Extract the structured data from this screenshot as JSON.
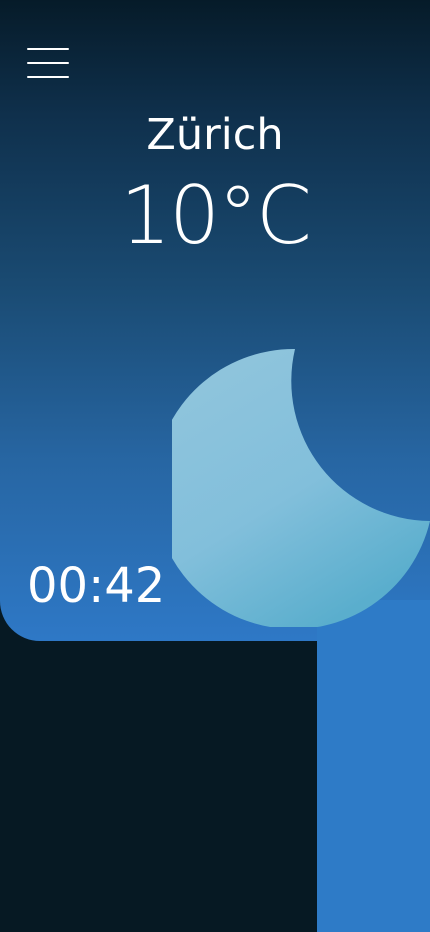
{
  "location": {
    "city": "Zürich"
  },
  "weather": {
    "temperature": "10°C",
    "condition_icon": "moon-icon"
  },
  "clock": {
    "time": "00:42"
  },
  "menu": {
    "icon": "hamburger-menu-icon"
  },
  "colors": {
    "sky_top": "#061b29",
    "sky_bottom": "#2e78c6",
    "moon_light": "#8ec3dc",
    "moon_dark": "#5aaecd",
    "background": "#061923"
  }
}
